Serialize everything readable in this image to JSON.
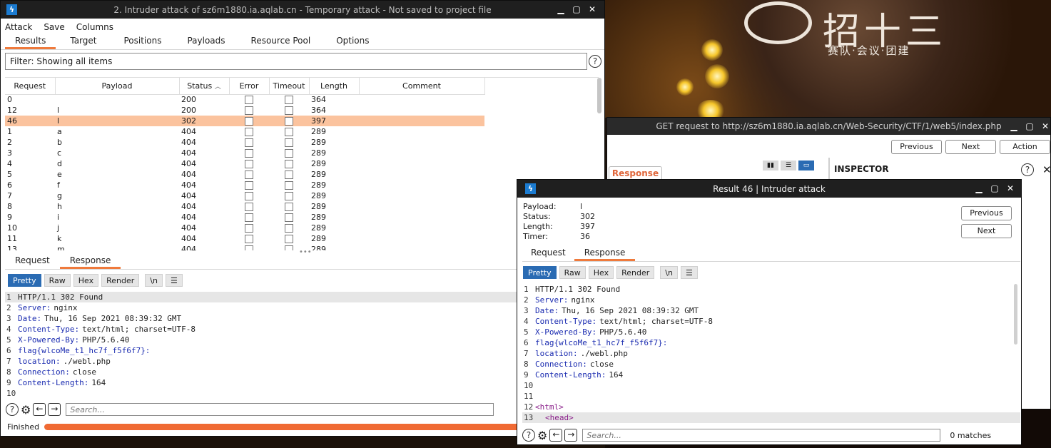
{
  "background": {
    "logo_text": "招十三",
    "logo_sub": "赛队·会议·团建"
  },
  "intruder": {
    "title": "2. Intruder attack of sz6m1880.ia.aqlab.cn - Temporary attack - Not saved to project file",
    "menu": [
      "Attack",
      "Save",
      "Columns"
    ],
    "tabs": [
      "Results",
      "Target",
      "Positions",
      "Payloads",
      "Resource Pool",
      "Options"
    ],
    "filter": "Filter: Showing all items",
    "columns": [
      "Request",
      "Payload",
      "Status",
      "Error",
      "Timeout",
      "Length",
      "Comment"
    ],
    "rows": [
      {
        "req": "0",
        "payload": "",
        "status": "200",
        "length": "364"
      },
      {
        "req": "12",
        "payload": "l",
        "status": "200",
        "length": "364"
      },
      {
        "req": "46",
        "payload": "l",
        "status": "302",
        "length": "397"
      },
      {
        "req": "1",
        "payload": "a",
        "status": "404",
        "length": "289"
      },
      {
        "req": "2",
        "payload": "b",
        "status": "404",
        "length": "289"
      },
      {
        "req": "3",
        "payload": "c",
        "status": "404",
        "length": "289"
      },
      {
        "req": "4",
        "payload": "d",
        "status": "404",
        "length": "289"
      },
      {
        "req": "5",
        "payload": "e",
        "status": "404",
        "length": "289"
      },
      {
        "req": "6",
        "payload": "f",
        "status": "404",
        "length": "289"
      },
      {
        "req": "7",
        "payload": "g",
        "status": "404",
        "length": "289"
      },
      {
        "req": "8",
        "payload": "h",
        "status": "404",
        "length": "289"
      },
      {
        "req": "9",
        "payload": "i",
        "status": "404",
        "length": "289"
      },
      {
        "req": "10",
        "payload": "j",
        "status": "404",
        "length": "289"
      },
      {
        "req": "11",
        "payload": "k",
        "status": "404",
        "length": "289"
      },
      {
        "req": "13",
        "payload": "m",
        "status": "404",
        "length": "289"
      }
    ],
    "selected_row": 2,
    "subtabs": [
      "Request",
      "Response"
    ],
    "view_buttons": [
      "Pretty",
      "Raw",
      "Hex",
      "Render",
      "\\n"
    ],
    "response_lines": [
      {
        "n": "1",
        "k": "HTTP/1.1 302 Found",
        "v": ""
      },
      {
        "n": "2",
        "k": "Server:",
        "v": "nginx"
      },
      {
        "n": "3",
        "k": "Date:",
        "v": "Thu, 16 Sep 2021 08:39:32 GMT"
      },
      {
        "n": "4",
        "k": "Content-Type:",
        "v": "text/html; charset=UTF-8"
      },
      {
        "n": "5",
        "k": "X-Powered-By:",
        "v": "PHP/5.6.40"
      },
      {
        "n": "6",
        "k": "flag{wlcoMe_t1_hc7f_f5f6f7}:",
        "v": ""
      },
      {
        "n": "7",
        "k": "location:",
        "v": "./webl.php"
      },
      {
        "n": "8",
        "k": "Connection:",
        "v": "close"
      },
      {
        "n": "9",
        "k": "Content-Length:",
        "v": "164"
      },
      {
        "n": "10",
        "k": "",
        "v": ""
      }
    ],
    "search_placeholder": "Search...",
    "status_text": "Finished"
  },
  "get_window": {
    "title": "GET request to http://sz6m1880.ia.aqlab.cn/Web-Security/CTF/1/web5/index.php",
    "buttons": [
      "Previous",
      "Next",
      "Action"
    ],
    "response_tab": "Response",
    "inspector": "INSPECTOR"
  },
  "result": {
    "title": "Result 46 | Intruder attack",
    "fields": [
      {
        "label": "Payload:",
        "value": "l"
      },
      {
        "label": "Status:",
        "value": "302"
      },
      {
        "label": "Length:",
        "value": "397"
      },
      {
        "label": "Timer:",
        "value": "36"
      }
    ],
    "previous": "Previous",
    "next": "Next",
    "subtabs": [
      "Request",
      "Response"
    ],
    "view_buttons": [
      "Pretty",
      "Raw",
      "Hex",
      "Render",
      "\\n"
    ],
    "response_lines": [
      {
        "n": "1",
        "k": "HTTP/1.1 302 Found",
        "v": ""
      },
      {
        "n": "2",
        "k": "Server:",
        "v": "nginx"
      },
      {
        "n": "3",
        "k": "Date:",
        "v": "Thu, 16 Sep 2021 08:39:32 GMT"
      },
      {
        "n": "4",
        "k": "Content-Type:",
        "v": "text/html; charset=UTF-8"
      },
      {
        "n": "5",
        "k": "X-Powered-By:",
        "v": "PHP/5.6.40"
      },
      {
        "n": "6",
        "k": "flag{wlcoMe_t1_hc7f_f5f6f7}:",
        "v": ""
      },
      {
        "n": "7",
        "k": "location:",
        "v": "./webl.php"
      },
      {
        "n": "8",
        "k": "Connection:",
        "v": "close"
      },
      {
        "n": "9",
        "k": "Content-Length:",
        "v": "164"
      },
      {
        "n": "10",
        "k": "",
        "v": ""
      },
      {
        "n": "11",
        "k": "",
        "v": ""
      },
      {
        "n": "12",
        "k": "",
        "v": "<html>"
      },
      {
        "n": "13",
        "k": "",
        "v": "<head>"
      }
    ],
    "search_placeholder": "Search...",
    "matches": "0 matches"
  }
}
